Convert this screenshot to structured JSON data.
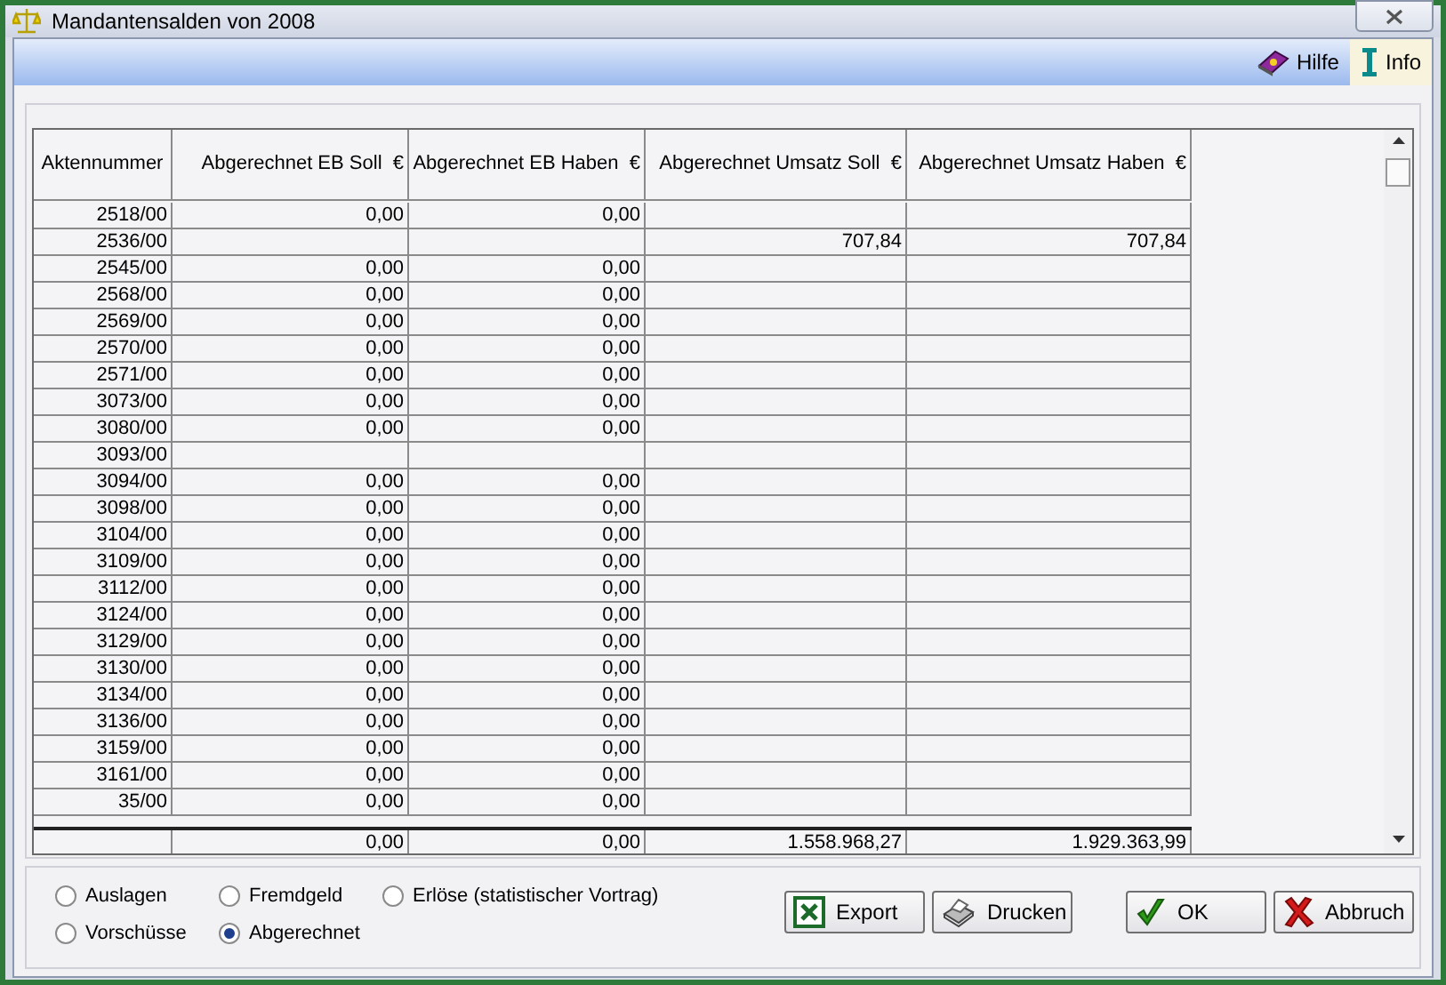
{
  "window": {
    "title": "Mandantensalden von 2008"
  },
  "toolbar": [
    {
      "label": "Hilfe",
      "kind": "book",
      "selected": false
    },
    {
      "label": "Info",
      "kind": "cursor",
      "selected": true
    }
  ],
  "table": {
    "columns": [
      "Aktennummer",
      "Abgerechnet EB Soll  €",
      "Abgerechnet EB Haben  €",
      "Abgerechnet Umsatz Soll  €",
      "Abgerechnet Umsatz Haben  €"
    ],
    "rows": [
      [
        "2518/00",
        "0,00",
        "0,00",
        null,
        null
      ],
      [
        "2536/00",
        null,
        null,
        "707,84",
        "707,84"
      ],
      [
        "2545/00",
        "0,00",
        "0,00",
        null,
        null
      ],
      [
        "2568/00",
        "0,00",
        "0,00",
        null,
        null
      ],
      [
        "2569/00",
        "0,00",
        "0,00",
        null,
        null
      ],
      [
        "2570/00",
        "0,00",
        "0,00",
        null,
        null
      ],
      [
        "2571/00",
        "0,00",
        "0,00",
        null,
        null
      ],
      [
        "3073/00",
        "0,00",
        "0,00",
        null,
        null
      ],
      [
        "3080/00",
        "0,00",
        "0,00",
        null,
        null
      ],
      [
        "3093/00",
        null,
        null,
        null,
        null
      ],
      [
        "3094/00",
        "0,00",
        "0,00",
        null,
        null
      ],
      [
        "3098/00",
        "0,00",
        "0,00",
        null,
        null
      ],
      [
        "3104/00",
        "0,00",
        "0,00",
        null,
        null
      ],
      [
        "3109/00",
        "0,00",
        "0,00",
        null,
        null
      ],
      [
        "3112/00",
        "0,00",
        "0,00",
        null,
        null
      ],
      [
        "3124/00",
        "0,00",
        "0,00",
        null,
        null
      ],
      [
        "3129/00",
        "0,00",
        "0,00",
        null,
        null
      ],
      [
        "3130/00",
        "0,00",
        "0,00",
        null,
        null
      ],
      [
        "3134/00",
        "0,00",
        "0,00",
        null,
        null
      ],
      [
        "3136/00",
        "0,00",
        "0,00",
        null,
        null
      ],
      [
        "3159/00",
        "0,00",
        "0,00",
        null,
        null
      ],
      [
        "3161/00",
        "0,00",
        "0,00",
        null,
        null
      ],
      [
        "35/00",
        "0,00",
        "0,00",
        null,
        null
      ]
    ],
    "totals": [
      "0,00",
      "0,00",
      "1.558.968,27",
      "1.929.363,99"
    ]
  },
  "filters": [
    {
      "label": "Auslagen",
      "selected": false
    },
    {
      "label": "Fremdgeld",
      "selected": false
    },
    {
      "label": "Erlöse (statistischer Vortrag)",
      "selected": false
    },
    {
      "label": "Vorschüsse",
      "selected": false
    },
    {
      "label": "Abgerechnet",
      "selected": true
    }
  ],
  "buttons": [
    {
      "label": "Export",
      "kind": "spreadsheet"
    },
    {
      "label": "Drucken",
      "kind": "printer"
    },
    {
      "label": "OK",
      "kind": "check"
    },
    {
      "label": "Abbruch",
      "kind": "cross"
    }
  ]
}
